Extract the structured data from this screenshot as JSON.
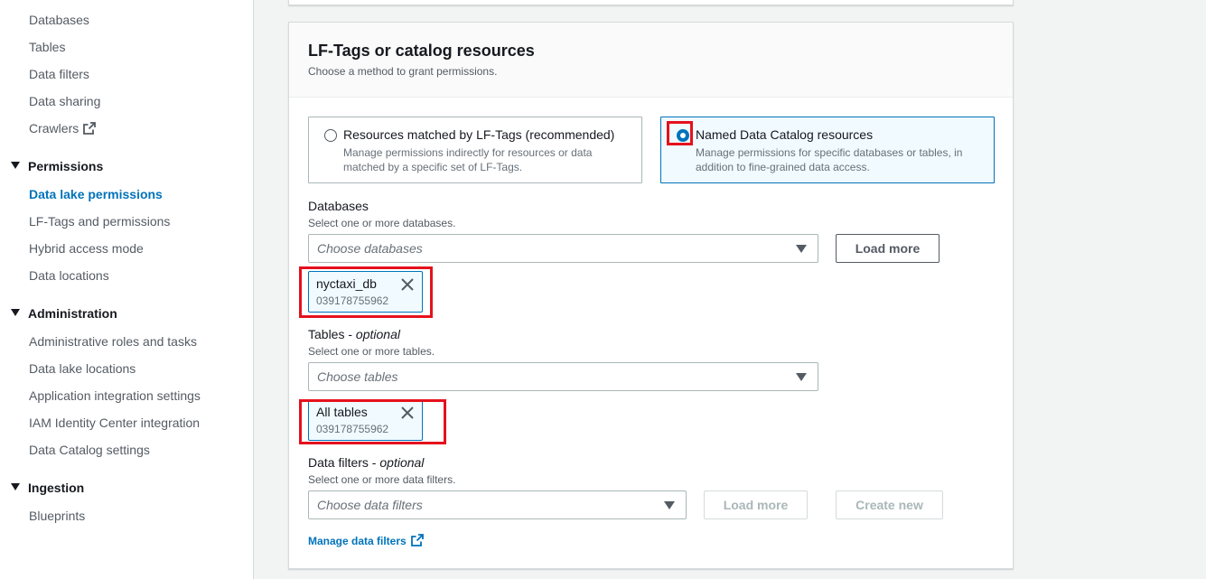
{
  "sidebar": {
    "items_top": [
      "Databases",
      "Tables",
      "Data filters",
      "Data sharing",
      "Crawlers"
    ],
    "permissions": {
      "title": "Permissions",
      "items": [
        "Data lake permissions",
        "LF-Tags and permissions",
        "Hybrid access mode",
        "Data locations"
      ]
    },
    "administration": {
      "title": "Administration",
      "items": [
        "Administrative roles and tasks",
        "Data lake locations",
        "Application integration settings",
        "IAM Identity Center integration",
        "Data Catalog settings"
      ]
    },
    "ingestion": {
      "title": "Ingestion",
      "items": [
        "Blueprints"
      ]
    },
    "active_item": "Data lake permissions"
  },
  "panel": {
    "title": "LF-Tags or catalog resources",
    "description": "Choose a method to grant permissions.",
    "options": [
      {
        "title": "Resources matched by LF-Tags (recommended)",
        "description": "Manage permissions indirectly for resources or data matched by a specific set of LF-Tags.",
        "selected": false
      },
      {
        "title": "Named Data Catalog resources",
        "description": "Manage permissions for specific databases or tables, in addition to fine-grained data access.",
        "selected": true
      }
    ],
    "databases": {
      "label": "Databases",
      "description": "Select one or more databases.",
      "placeholder": "Choose databases",
      "load_more": "Load more",
      "token": {
        "name": "nyctaxi_db",
        "account": "039178755962"
      }
    },
    "tables": {
      "label": "Tables",
      "optional": "optional",
      "description": "Select one or more tables.",
      "placeholder": "Choose tables",
      "token": {
        "name": "All tables",
        "account": "039178755962"
      }
    },
    "data_filters": {
      "label": "Data filters",
      "optional": "optional",
      "description": "Select one or more data filters.",
      "placeholder": "Choose data filters",
      "load_more": "Load more",
      "create_new": "Create new"
    },
    "manage_link": "Manage data filters"
  },
  "colors": {
    "accent": "#0073bb",
    "highlight": "#e5111d",
    "selected_tile_bg": "#f1faff"
  }
}
